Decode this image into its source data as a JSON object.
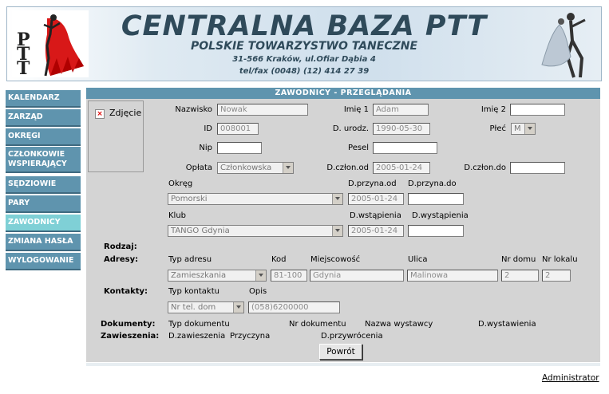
{
  "header": {
    "title": "CENTRALNA BAZA PTT",
    "subtitle": "POLSKIE TOWARZYSTWO TANECZNE",
    "address": "31-566 Kraków, ul.Ofiar Dąbia 4",
    "phone": "tel/fax (0048) (12) 414 27 39"
  },
  "menu": [
    {
      "label": "KALENDARZ"
    },
    {
      "label": "ZARZĄD"
    },
    {
      "label": "OKRĘGI"
    },
    {
      "label": "CZŁONKOWIE WSPIERAJĄCY"
    },
    {
      "label": "SĘDZIOWIE"
    },
    {
      "label": "PARY"
    },
    {
      "label": "ZAWODNICY"
    },
    {
      "label": "ZMIANA HASŁA"
    },
    {
      "label": "WYLOGOWANIE"
    }
  ],
  "panel": {
    "title": "ZAWODNICY - PRZEGLĄDANIA",
    "photo_label": "Zdjęcie",
    "fields": {
      "nazwisko": {
        "label": "Nazwisko",
        "value": "Nowak"
      },
      "imie1": {
        "label": "Imię 1",
        "value": "Adam"
      },
      "imie2": {
        "label": "Imię 2",
        "value": ""
      },
      "id": {
        "label": "ID",
        "value": "008001"
      },
      "durodz": {
        "label": "D. urodz.",
        "value": "1990-05-30"
      },
      "plec": {
        "label": "Płeć",
        "value": "M"
      },
      "nip": {
        "label": "Nip",
        "value": ""
      },
      "pesel": {
        "label": "Pesel",
        "value": ""
      },
      "oplata": {
        "label": "Opłata",
        "value": "Członkowska"
      },
      "dczlonod": {
        "label": "D.człon.od",
        "value": "2005-01-24"
      },
      "dczlondo": {
        "label": "D.człon.do",
        "value": ""
      },
      "okreg": {
        "label": "Okręg",
        "value": "Pomorski"
      },
      "dprzynaod": {
        "label": "D.przyna.od",
        "value": "2005-01-24"
      },
      "dprzynado": {
        "label": "D.przyna.do",
        "value": ""
      },
      "klub": {
        "label": "Klub",
        "value": "TANGO Gdynia"
      },
      "dwstapienia": {
        "label": "D.wstąpienia",
        "value": "2005-01-24"
      },
      "dwystapienia": {
        "label": "D.wystąpienia",
        "value": ""
      }
    },
    "rodzaj_label": "Rodzaj:",
    "adresy": {
      "label": "Adresy:",
      "headers": [
        "Typ adresu",
        "Kod",
        "Miejscowość",
        "Ulica",
        "Nr domu",
        "Nr lokalu"
      ],
      "row": [
        "Zamieszkania",
        "81-100",
        "Gdynia",
        "Malinowa",
        "2",
        "2"
      ]
    },
    "kontakty": {
      "label": "Kontakty:",
      "headers": [
        "Typ kontaktu",
        "Opis"
      ],
      "row": [
        "Nr tel. dom",
        "(058)6200000"
      ]
    },
    "dokumenty": {
      "label": "Dokumenty:",
      "headers": [
        "Typ dokumentu",
        "Nr dokumentu",
        "Nazwa wystawcy",
        "D.wystawienia"
      ]
    },
    "zawieszenia": {
      "label": "Zawieszenia:",
      "headers": [
        "D.zawieszenia",
        "Przyczyna",
        "D.przywrócenia"
      ]
    },
    "back_button": "Powrót"
  },
  "footer": {
    "user": "Administrator"
  }
}
